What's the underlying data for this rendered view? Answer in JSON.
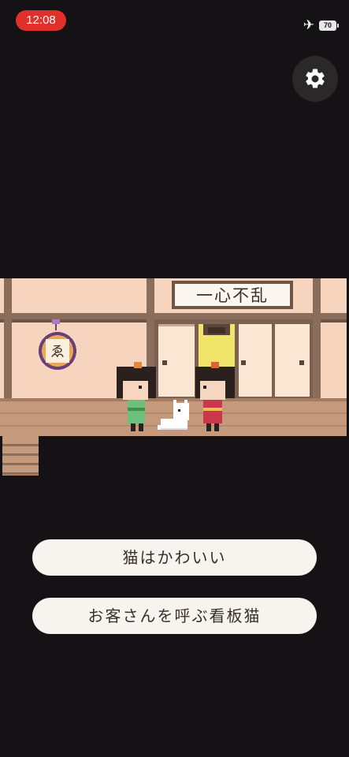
{
  "status_bar": {
    "time": "12:08",
    "battery": "70"
  },
  "scene": {
    "banner_text": "一心不乱",
    "scroll_glyph": "ゑ"
  },
  "icons": {
    "settings": "gear-icon",
    "airplane": "airplane-icon"
  },
  "choices": [
    {
      "label": "猫はかわいい"
    },
    {
      "label": "お客さんを呼ぶ看板猫"
    }
  ]
}
